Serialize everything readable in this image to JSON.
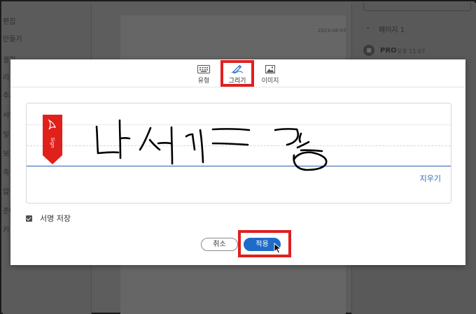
{
  "background": {
    "left_tools": [
      "편집",
      "만들기",
      "결합",
      "리 구",
      "추기",
      "서명",
      "및 C",
      "보호",
      "측정",
      "압축",
      "준비",
      "키 및"
    ],
    "doc_date": "2023-08-07",
    "right_panel": {
      "page_label": "페이지 1",
      "pro_icon": "PRO-badge-icon",
      "pro_label": "PRO",
      "time": "오후 11:07"
    }
  },
  "dialog": {
    "tabs": [
      {
        "label": "유형",
        "icon": "keyboard-icon",
        "active": false
      },
      {
        "label": "그리기",
        "icon": "pen-icon",
        "active": true
      },
      {
        "label": "이미지",
        "icon": "image-icon",
        "active": false
      }
    ],
    "sign_tag_text": "Sign",
    "clear_label": "지우기",
    "save_signature_label": "서명 저장",
    "save_signature_checked": true,
    "cancel_label": "취소",
    "apply_label": "적용"
  },
  "colors": {
    "accent": "#1f6bc9",
    "highlight": "#e02020",
    "sign_tag": "#e0201b"
  }
}
